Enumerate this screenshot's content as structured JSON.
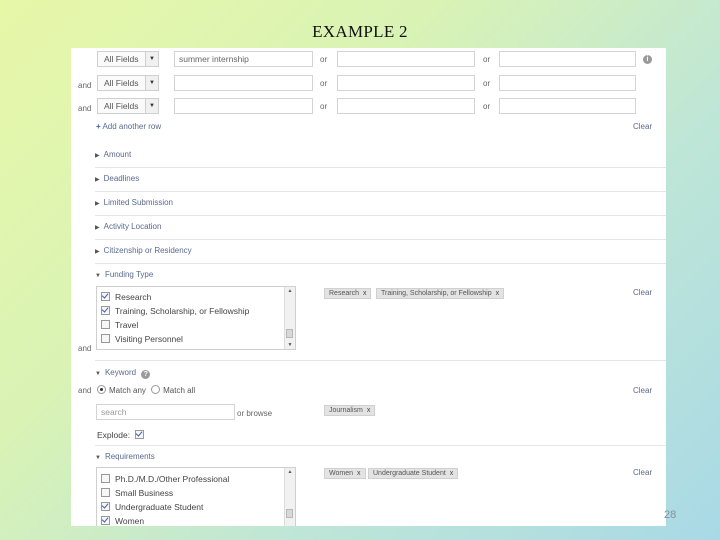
{
  "slide": {
    "title": "EXAMPLE 2",
    "page_number": "28"
  },
  "query_rows": [
    {
      "connector": "",
      "field": "All Fields",
      "term": "summer internship",
      "or1": "or",
      "or2": "or"
    },
    {
      "connector": "and",
      "field": "All Fields",
      "term": "",
      "or1": "or",
      "or2": "or"
    },
    {
      "connector": "and",
      "field": "All Fields",
      "term": "",
      "or1": "or",
      "or2": "or"
    }
  ],
  "add_row_label": "Add another row",
  "clear_label": "Clear",
  "collapsed_sections": [
    "Amount",
    "Deadlines",
    "Limited Submission",
    "Activity Location",
    "Citizenship or Residency"
  ],
  "funding_type": {
    "label": "Funding Type",
    "connector": "and",
    "items": [
      {
        "label": "Research",
        "checked": true
      },
      {
        "label": "Training, Scholarship, or Fellowship",
        "checked": true
      },
      {
        "label": "Travel",
        "checked": false
      },
      {
        "label": "Visiting Personnel",
        "checked": false
      }
    ],
    "chips": [
      "Research",
      "Training, Scholarship, or Fellowship"
    ]
  },
  "keyword": {
    "label": "Keyword",
    "connector": "and",
    "match_any": "Match any",
    "match_all": "Match all",
    "search_placeholder": "search",
    "browse_label": "or browse",
    "explode_label": "Explode:",
    "explode_checked": true,
    "chips": [
      "Journalism"
    ]
  },
  "requirements": {
    "label": "Requirements",
    "items": [
      {
        "label": "Ph.D./M.D./Other Professional",
        "checked": false
      },
      {
        "label": "Small Business",
        "checked": false
      },
      {
        "label": "Undergraduate Student",
        "checked": true
      },
      {
        "label": "Women",
        "checked": true
      }
    ],
    "chips": [
      "Women",
      "Undergraduate Student"
    ]
  },
  "chip_remove_glyph": "x",
  "icons": {
    "dropdown": "chevron-down-icon",
    "info": "info-icon",
    "plus": "plus-icon",
    "triangle": "triangle-right-icon"
  }
}
